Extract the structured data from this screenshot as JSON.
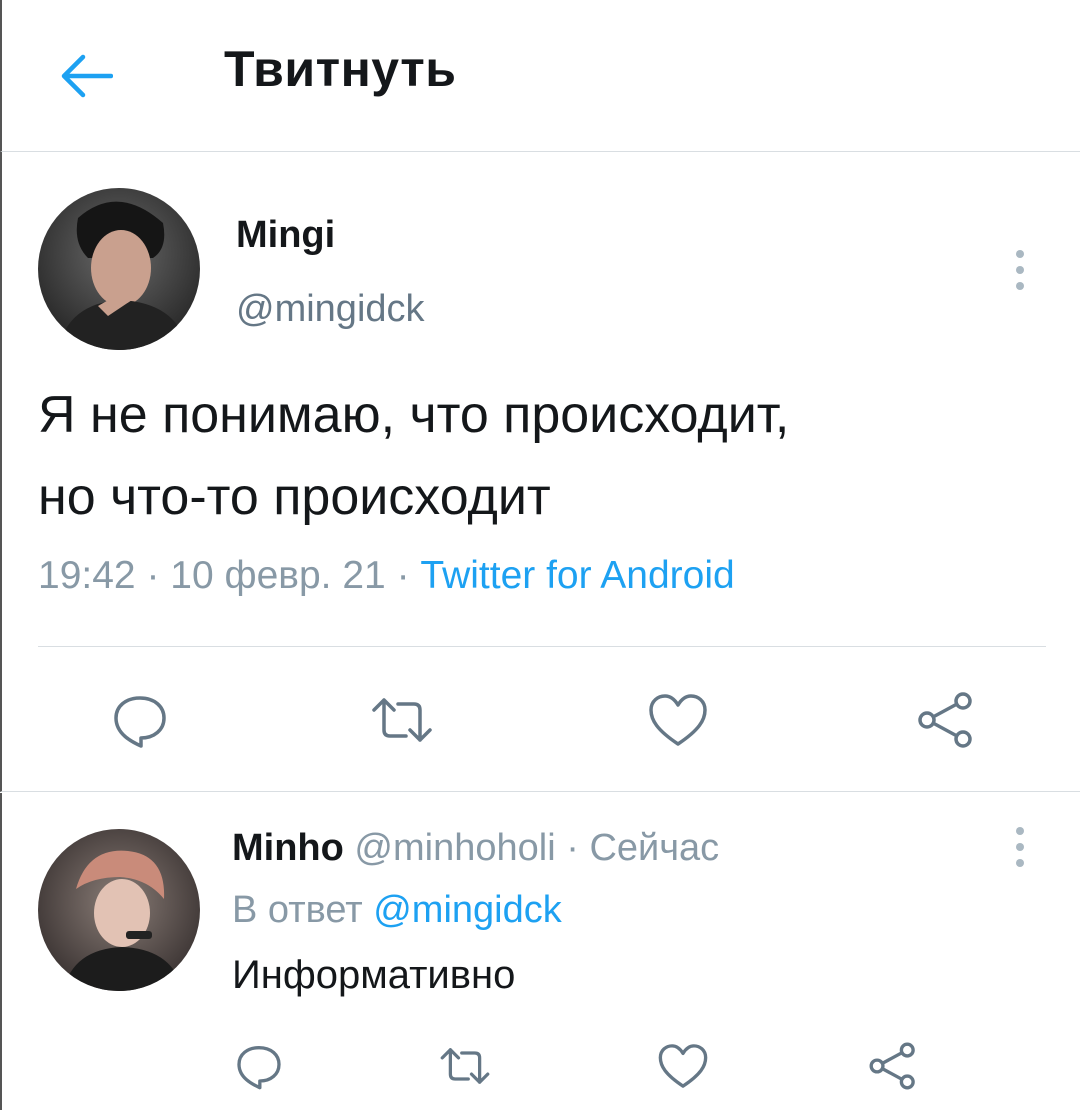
{
  "header": {
    "back_icon": "arrow-left-icon",
    "title": "Твитнуть"
  },
  "main_tweet": {
    "author_name": "Mingi",
    "author_handle": "@mingidck",
    "text_line1": "Я не понимаю, что происходит,",
    "text_line2": "но что-то происходит",
    "time": "19:42",
    "date": "10 февр. 21",
    "source": "Twitter for Android",
    "separator": " · ",
    "actions": [
      "reply-icon",
      "retweet-icon",
      "like-icon",
      "share-icon"
    ]
  },
  "reply_tweet": {
    "author_name": "Minho",
    "author_handle": "@minhoholi",
    "time": "Сейчас",
    "separator": " · ",
    "reply_prefix": "В ответ",
    "reply_mention": "@mingidck",
    "text": "Информативно",
    "actions": [
      "reply-icon",
      "retweet-icon",
      "like-icon",
      "share-icon"
    ]
  },
  "colors": {
    "accent": "#1da1f2",
    "secondary_text": "#8899a6",
    "icon_gray": "#657786",
    "divider": "#d9dee2"
  }
}
